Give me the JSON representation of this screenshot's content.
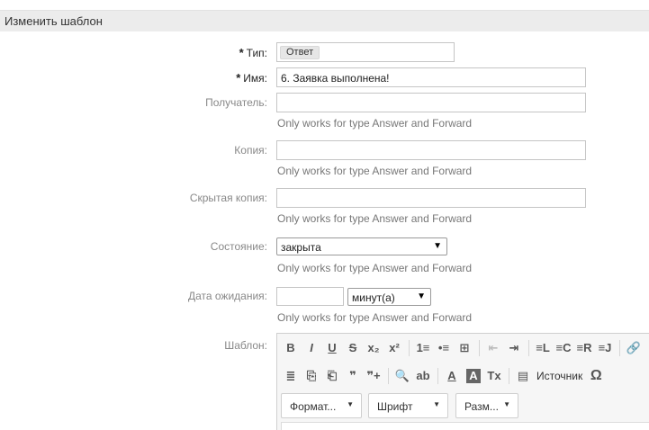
{
  "header": {
    "title": "Изменить шаблон"
  },
  "form": {
    "type": {
      "label": "Тип:",
      "required": true,
      "value": "Ответ"
    },
    "name": {
      "label": "Имя:",
      "required": true,
      "value": "6. Заявка выполнена!"
    },
    "recipient": {
      "label": "Получатель:",
      "value": "",
      "hint": "Only works for type Answer and Forward"
    },
    "cc": {
      "label": "Копия:",
      "value": "",
      "hint": "Only works for type Answer and Forward"
    },
    "bcc": {
      "label": "Скрытая копия:",
      "value": "",
      "hint": "Only works for type Answer and Forward"
    },
    "state": {
      "label": "Состояние:",
      "value": "закрыта",
      "hint": "Only works for type Answer and Forward"
    },
    "pending": {
      "label": "Дата ожидания:",
      "value": "",
      "unit": "минут(а)",
      "hint": "Only works for type Answer and Forward"
    },
    "template": {
      "label": "Шаблон:"
    }
  },
  "editor": {
    "row1": [
      "B",
      "I",
      "U",
      "S",
      "x₂",
      "x²",
      "1≡",
      "•≡",
      "⊞",
      "⇤",
      "⇥",
      "≡L",
      "≡C",
      "≡R",
      "≡J",
      "🔗"
    ],
    "row2": [
      "≣",
      "⎘",
      "⎗",
      "❞",
      "❞+",
      "🔍",
      "ab",
      "A",
      "A",
      "Tx",
      "▤"
    ],
    "source_label": "Источник",
    "omega": "Ω",
    "format_label": "Формат...",
    "font_label": "Шрифт",
    "size_label": "Разм..."
  }
}
